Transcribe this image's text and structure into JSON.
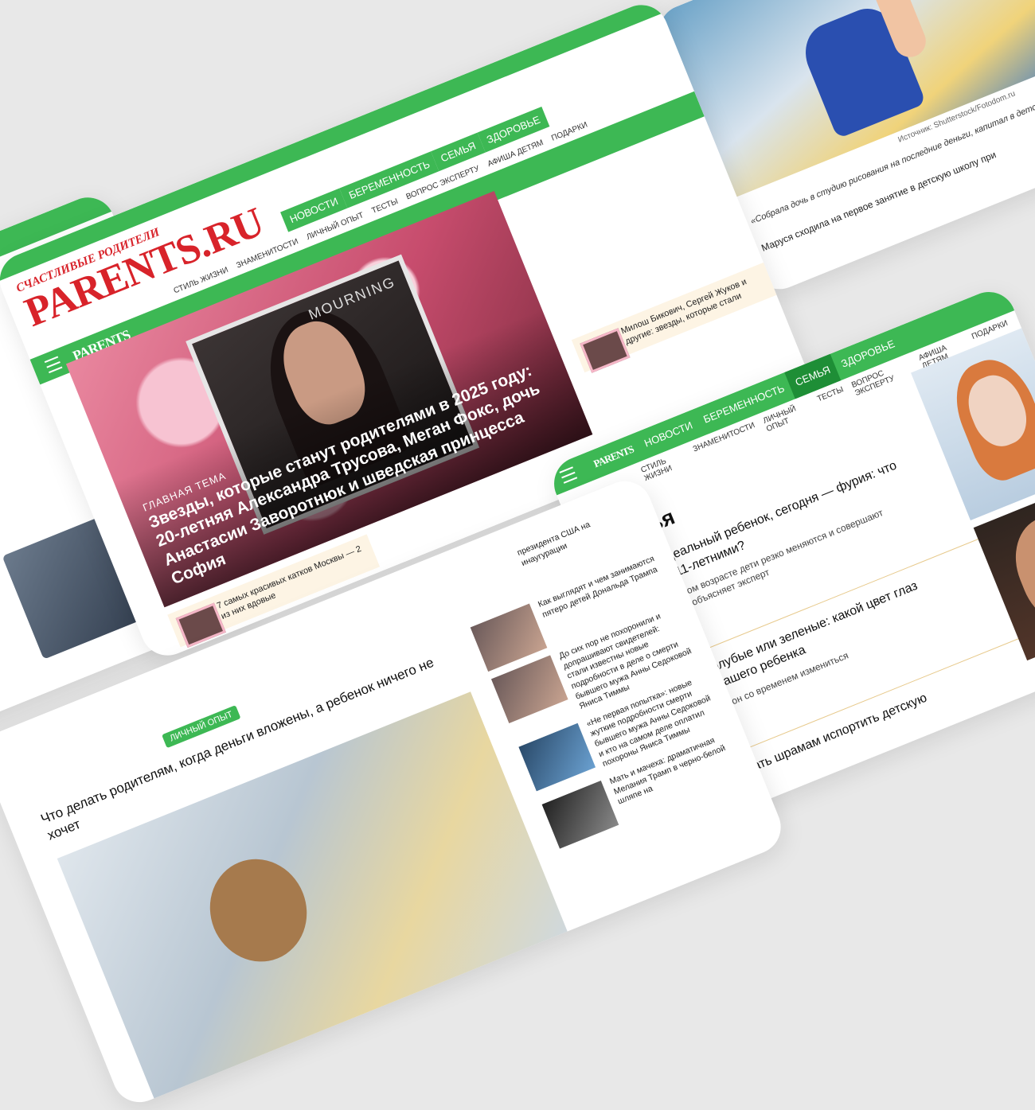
{
  "brand": {
    "tagline": "СЧАСТЛИВЫЕ РОДИТЕЛИ",
    "logo": "PARENTS.RU",
    "mini_logo": "PARENTS",
    "accent": "#3db854",
    "accent_dark": "#1e8e36",
    "logo_color": "#d8232a"
  },
  "main_nav": [
    "НОВОСТИ",
    "БЕРЕМЕННОСТЬ",
    "СЕМЬЯ",
    "ЗДОРОВЬЕ"
  ],
  "sub_nav": [
    "СТИЛЬ ЖИЗНИ",
    "ЗНАМЕНИТОСТИ",
    "ЛИЧНЫЙ ОПЫТ",
    "ТЕСТЫ",
    "ВОПРОС ЭКСПЕРТУ",
    "АФИША ДЕТЯМ",
    "ПОДАРКИ"
  ],
  "home": {
    "hero_tag": "ГЛАВНАЯ ТЕМА",
    "hero_title": "Звезды, которые станут родителями в 2025 году: 20-летняя Александра Трусова, Меган Фокс, дочь Анастасии Заворотнюк и шведская принцесса София",
    "hero_photo_text": "MOURNING",
    "side_item_1": "Милош Бикович, Сергей Жуков и другие: звезды, которые стали",
    "side_item_2": "7 самых красивых катков Москвы — 2 из них вдовые"
  },
  "family": {
    "active_nav": "СЕМЬЯ",
    "heading": "Семья",
    "articles": [
      {
        "title": "Вчера идеальный ребенок, сегодня — фурия: что не так с 11-летними?",
        "desc": "Почему в этом возрасте дети резко меняются и совершают глупости — объясняет эксперт"
      },
      {
        "title": "Карие, голубые или зеленые: какой цвет глаз будет у вашего ребенка",
        "desc": "И может ли он со временем измениться"
      },
      {
        "title": "Как не дать шрамам испортить детскую",
        "desc": ""
      }
    ]
  },
  "article": {
    "tag": "ЛИЧНЫЙ ОПЫТ",
    "title": "Что делать родителям, когда деньги вложены, а ребенок ничего не хочет",
    "sidebar": [
      "президента США на инаугурации",
      "Как выглядят и чем занимаются пятеро детей Дональда Трампа",
      "До сих пор не похоронили и допрашивают свидетелей: стали известны новые подробности в деле о смерти бывшего мужа Анны Седоковой Яниса Тиммы",
      "«Не первая попытка»: новые жуткие подробности смерти бывшего мужа Анны Седоковой и кто на самом деле оплатил похороны Янисa Тиммы",
      "Мать и мачеха: драматичная Мелания Трамп в черно-белой шляпе на"
    ]
  },
  "source_card": {
    "credit": "Источник: Shutterstock/Fotodom.ru",
    "caption": "«Собрала дочь в студию рисования на последние деньги, капитал в детскую школу при",
    "body": "Маруся сходила на первое занятие в детскую школу при"
  }
}
